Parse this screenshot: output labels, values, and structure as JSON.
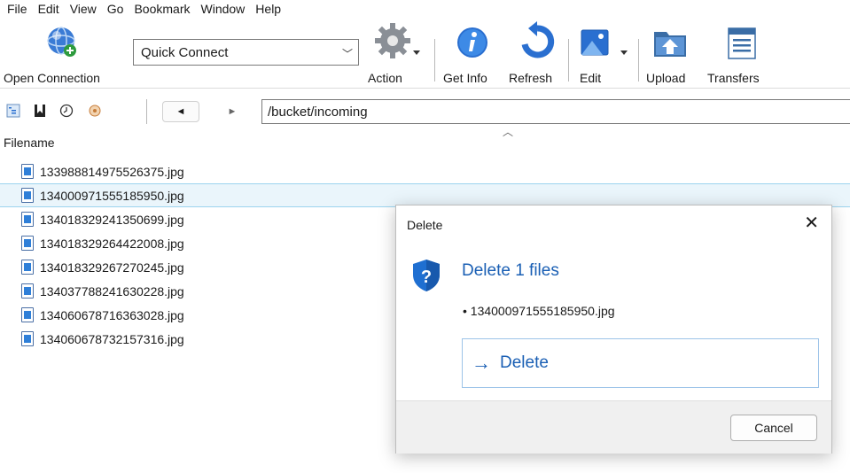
{
  "menu": [
    "File",
    "Edit",
    "View",
    "Go",
    "Bookmark",
    "Window",
    "Help"
  ],
  "toolbar": {
    "open_connection": "Open Connection",
    "quick_connect": "Quick Connect",
    "action": "Action",
    "get_info": "Get Info",
    "refresh": "Refresh",
    "edit": "Edit",
    "upload": "Upload",
    "transfers": "Transfers"
  },
  "navbar": {
    "back_glyph": "◄",
    "forward_glyph": "►",
    "path": "/bucket/incoming"
  },
  "file_list": {
    "column_header": "Filename",
    "files": [
      "133988814975526375.jpg",
      "134000971555185950.jpg",
      "134018329241350699.jpg",
      "134018329264422008.jpg",
      "134018329267270245.jpg",
      "134037788241630228.jpg",
      "134060678716363028.jpg",
      "134060678732157316.jpg"
    ],
    "selected_index": 1
  },
  "dialog": {
    "title": "Delete",
    "close_glyph": "✕",
    "heading": "Delete 1 files",
    "item": "• 134000971555185950.jpg",
    "delete_arrow": "→",
    "delete_label": "Delete",
    "cancel_label": "Cancel"
  },
  "colors": {
    "accent_blue": "#1a5fb4",
    "selection_bg": "#eaf5fb",
    "selection_border": "#9cd3ee"
  }
}
